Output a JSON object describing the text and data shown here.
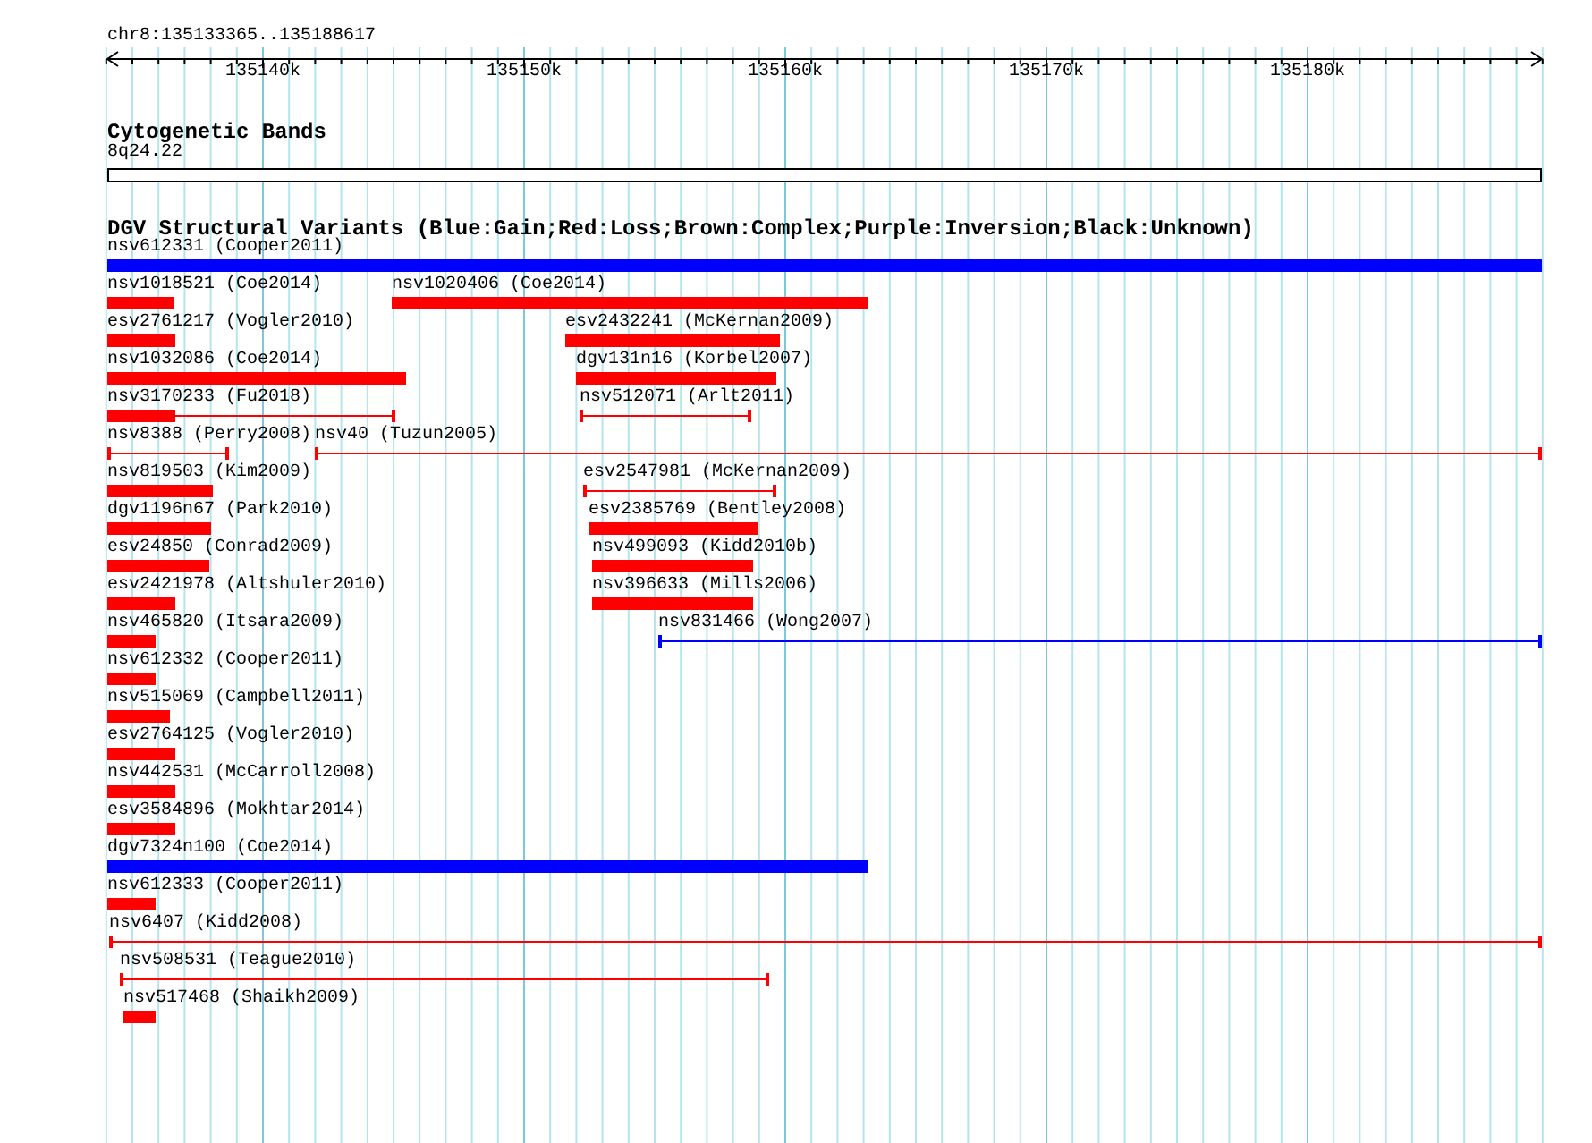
{
  "ruler": {
    "label": "chr8:135133365..135188617",
    "ticks": [
      "135140k",
      "135150k",
      "135160k",
      "135170k",
      "135180k"
    ]
  },
  "cytogenetic_bands": {
    "title": "Cytogenetic Bands",
    "band": "8q24.22"
  },
  "dgv_track": {
    "title": "DGV Structural Variants (Blue:Gain;Red:Loss;Brown:Complex;Purple:Inversion;Black:Unknown)",
    "features": [
      {
        "label": "nsv612331 (Cooper2011)",
        "kind": "block",
        "color": "#0000ff"
      },
      {
        "label": "nsv1018521 (Coe2014)",
        "kind": "block",
        "color": "#ff0000"
      },
      {
        "label": "nsv1020406 (Coe2014)",
        "kind": "block",
        "color": "#ff0000"
      },
      {
        "label": "esv2761217 (Vogler2010)",
        "kind": "block",
        "color": "#ff0000"
      },
      {
        "label": "esv2432241 (McKernan2009)",
        "kind": "block",
        "color": "#ff0000"
      },
      {
        "label": "nsv1032086 (Coe2014)",
        "kind": "block",
        "color": "#ff0000"
      },
      {
        "label": "dgv131n16 (Korbel2007)",
        "kind": "block",
        "color": "#ff0000"
      },
      {
        "label": "nsv3170233 (Fu2018)",
        "kind": "block_span",
        "color": "#ff0000"
      },
      {
        "label": "nsv512071 (Arlt2011)",
        "kind": "span",
        "color": "#ff0000"
      },
      {
        "label": "nsv8388 (Perry2008)",
        "kind": "span",
        "color": "#ff0000"
      },
      {
        "label": "nsv40 (Tuzun2005)",
        "kind": "span",
        "color": "#ff0000"
      },
      {
        "label": "nsv819503 (Kim2009)",
        "kind": "block",
        "color": "#ff0000"
      },
      {
        "label": "esv2547981 (McKernan2009)",
        "kind": "span",
        "color": "#ff0000"
      },
      {
        "label": "dgv1196n67 (Park2010)",
        "kind": "block",
        "color": "#ff0000"
      },
      {
        "label": "esv2385769 (Bentley2008)",
        "kind": "capped_block",
        "color": "#ff0000"
      },
      {
        "label": "esv24850 (Conrad2009)",
        "kind": "block",
        "color": "#ff0000"
      },
      {
        "label": "nsv499093 (Kidd2010b)",
        "kind": "block",
        "color": "#ff0000"
      },
      {
        "label": "esv2421978 (Altshuler2010)",
        "kind": "block",
        "color": "#ff0000"
      },
      {
        "label": "nsv396633 (Mills2006)",
        "kind": "block",
        "color": "#ff0000"
      },
      {
        "label": "nsv465820 (Itsara2009)",
        "kind": "block",
        "color": "#ff0000"
      },
      {
        "label": "nsv831466 (Wong2007)",
        "kind": "span",
        "color": "#0000ff"
      },
      {
        "label": "nsv612332 (Cooper2011)",
        "kind": "block",
        "color": "#ff0000"
      },
      {
        "label": "nsv515069 (Campbell2011)",
        "kind": "block",
        "color": "#ff0000"
      },
      {
        "label": "esv2764125 (Vogler2010)",
        "kind": "block",
        "color": "#ff0000"
      },
      {
        "label": "nsv442531 (McCarroll2008)",
        "kind": "block",
        "color": "#ff0000"
      },
      {
        "label": "esv3584896 (Mokhtar2014)",
        "kind": "block",
        "color": "#ff0000"
      },
      {
        "label": "dgv7324n100 (Coe2014)",
        "kind": "block",
        "color": "#0000ff"
      },
      {
        "label": "nsv612333 (Cooper2011)",
        "kind": "block",
        "color": "#ff0000"
      },
      {
        "label": "nsv6407 (Kidd2008)",
        "kind": "span",
        "color": "#ff0000"
      },
      {
        "label": "nsv508531 (Teague2010)",
        "kind": "span",
        "color": "#ff0000"
      },
      {
        "label": "nsv517468 (Shaikh2009)",
        "kind": "block",
        "color": "#ff0000"
      }
    ]
  }
}
